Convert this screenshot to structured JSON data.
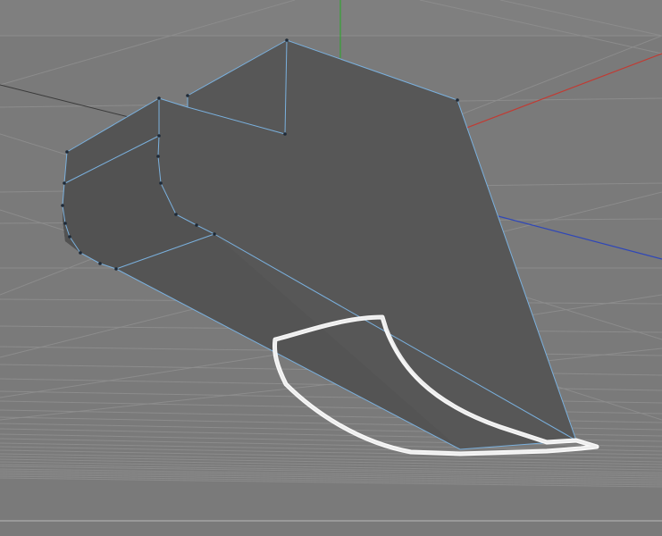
{
  "viewport": {
    "background_color": "#7a7a7a",
    "grid_color": "#8a8a8a",
    "object_face_color": "#575757",
    "edge_color": "#7ab0dd",
    "selection_outline_color": "#ffffff",
    "axis_x_color": "#c23a32",
    "axis_y_color": "#35a335",
    "axis_z_color": "#2f47b8",
    "icons": {
      "axis_x": "axis-x-line",
      "axis_y": "axis-y-line",
      "axis_z": "axis-z-line",
      "grid": "floor-grid",
      "object": "extruded-mesh",
      "selection": "freehand-selection-outline"
    }
  }
}
